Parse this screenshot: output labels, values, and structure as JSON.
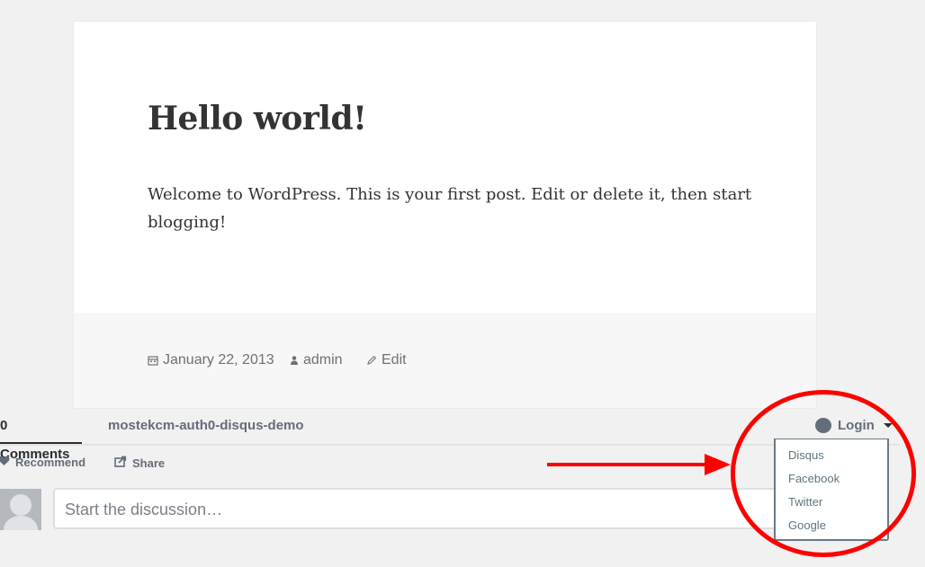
{
  "post": {
    "title": "Hello world!",
    "body": "Welcome to WordPress. This is your first post. Edit or delete it, then start blogging!",
    "date": "January 22, 2013",
    "author": "admin",
    "edit_label": "Edit"
  },
  "disqus": {
    "comments_tab": "0 Comments",
    "site_tab": "mostekcm-auth0-disqus-demo",
    "login_label": "Login",
    "recommend_label": "Recommend",
    "share_label": "Share",
    "comment_placeholder": "Start the discussion…",
    "login_menu": [
      {
        "label": "Disqus"
      },
      {
        "label": "Facebook"
      },
      {
        "label": "Twitter"
      },
      {
        "label": "Google"
      }
    ]
  },
  "annotation": {
    "color": "#ff0000"
  }
}
